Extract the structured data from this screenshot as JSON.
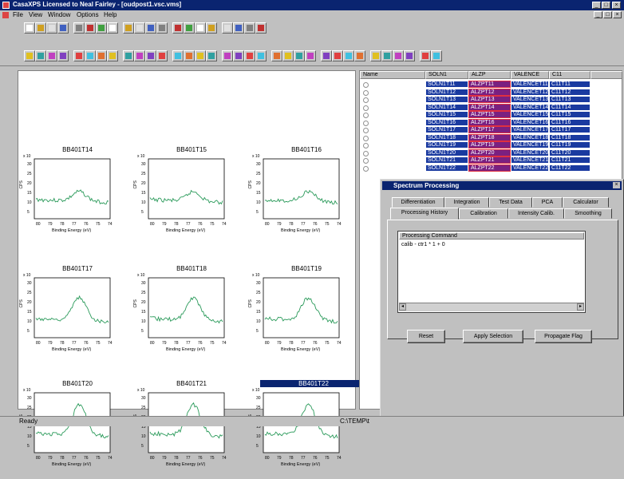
{
  "window": {
    "title": "CasaXPS Licensed to Neal Fairley - [oudpost1.vsc.vms]"
  },
  "menu": [
    "File",
    "View",
    "Window",
    "Options",
    "Help"
  ],
  "plots": [
    {
      "title": "BB401T14",
      "selected": false
    },
    {
      "title": "BB401T15",
      "selected": false
    },
    {
      "title": "BB401T16",
      "selected": false
    },
    {
      "title": "BB401T17",
      "selected": false
    },
    {
      "title": "BB401T18",
      "selected": false
    },
    {
      "title": "BB401T19",
      "selected": false
    },
    {
      "title": "BB401T20",
      "selected": false
    },
    {
      "title": "BB401T21",
      "selected": false
    },
    {
      "title": "BB401T22",
      "selected": true
    }
  ],
  "plot_axis": {
    "xlabel": "Binding Energy (eV)",
    "ylabel": "CPS",
    "xticks": [
      "80",
      "79",
      "78",
      "77",
      "76",
      "75",
      "74"
    ],
    "yticks": [
      "30",
      "25",
      "20",
      "15",
      "10",
      "5"
    ],
    "exponent": "x 10"
  },
  "grid": {
    "columns": [
      "Name",
      "SOLN1",
      "ALZP",
      "VALENCE",
      "C11"
    ],
    "rows": [
      [
        "SOLN1T11",
        "ALZPT11",
        "VALENCET11",
        "C11T11"
      ],
      [
        "SOLN1T12",
        "ALZPT12",
        "VALENCET12",
        "C11T12"
      ],
      [
        "SOLN1T13",
        "ALZPT13",
        "VALENCET13",
        "C11T13"
      ],
      [
        "SOLN1T14",
        "ALZPT14",
        "VALENCET14",
        "C11T14"
      ],
      [
        "SOLN1T15",
        "ALZPT15",
        "VALENCET15",
        "C11T15"
      ],
      [
        "SOLN1T16",
        "ALZPT16",
        "VALENCET16",
        "C11T16"
      ],
      [
        "SOLN1T17",
        "ALZPT17",
        "VALENCET17",
        "C11T17"
      ],
      [
        "SOLN1T18",
        "ALZPT18",
        "VALENCET18",
        "C11T18"
      ],
      [
        "SOLN1T19",
        "ALZPT19",
        "VALENCET19",
        "C11T19"
      ],
      [
        "SOLN1T20",
        "ALZPT20",
        "VALENCET20",
        "C11T20"
      ],
      [
        "SOLN1T21",
        "ALZPT21",
        "VALENCET21",
        "C11T21"
      ],
      [
        "SOLN1T22",
        "ALZPT22",
        "VALENCET22",
        "C11T22"
      ]
    ]
  },
  "dialog": {
    "title": "Spectrum Processing",
    "tabs_row1": [
      "Differentiation",
      "Integration",
      "Test Data",
      "PCA",
      "Calculator"
    ],
    "tabs_row2": [
      "Processing History",
      "Calibration",
      "Intensity Calib.",
      "Smoothing"
    ],
    "list_header": "Processing Command",
    "list_items": [
      "calib - ctr1 * 1 + 0"
    ],
    "buttons": {
      "reset": "Reset",
      "apply": "Apply Selection",
      "propagate": "Propagate Flag"
    }
  },
  "status": {
    "left": "Ready",
    "right": "C:\\TEMP\\t"
  }
}
